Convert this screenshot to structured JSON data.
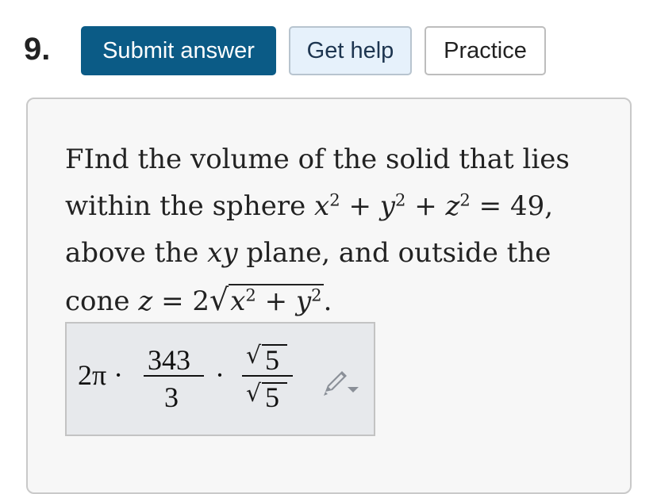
{
  "question": {
    "number": "9.",
    "buttons": {
      "submit_label": "Submit answer",
      "help_label": "Get help",
      "practice_label": "Practice"
    },
    "text": {
      "line1": "FInd the volume of the solid that lies",
      "line2_prefix": "within the sphere ",
      "line2_eq_end": " = 49,",
      "line3_prefix": "above the ",
      "line3_var": "xy",
      "line3_suffix": " plane, and outside the",
      "line4_prefix": "cone ",
      "line4_eq": " = 2",
      "line4_end": "."
    }
  },
  "answer": {
    "coefficient": "2π ·",
    "frac1_num": "343",
    "frac1_den": "3",
    "dot": "·",
    "frac2_num": "5",
    "frac2_den": "5",
    "edit_icon": "pencil-icon"
  },
  "colors": {
    "submit_bg": "#0b5b86",
    "help_bg": "#e6f1fb",
    "answer_bg": "#e7e9ec",
    "card_bg": "#f7f7f7"
  }
}
